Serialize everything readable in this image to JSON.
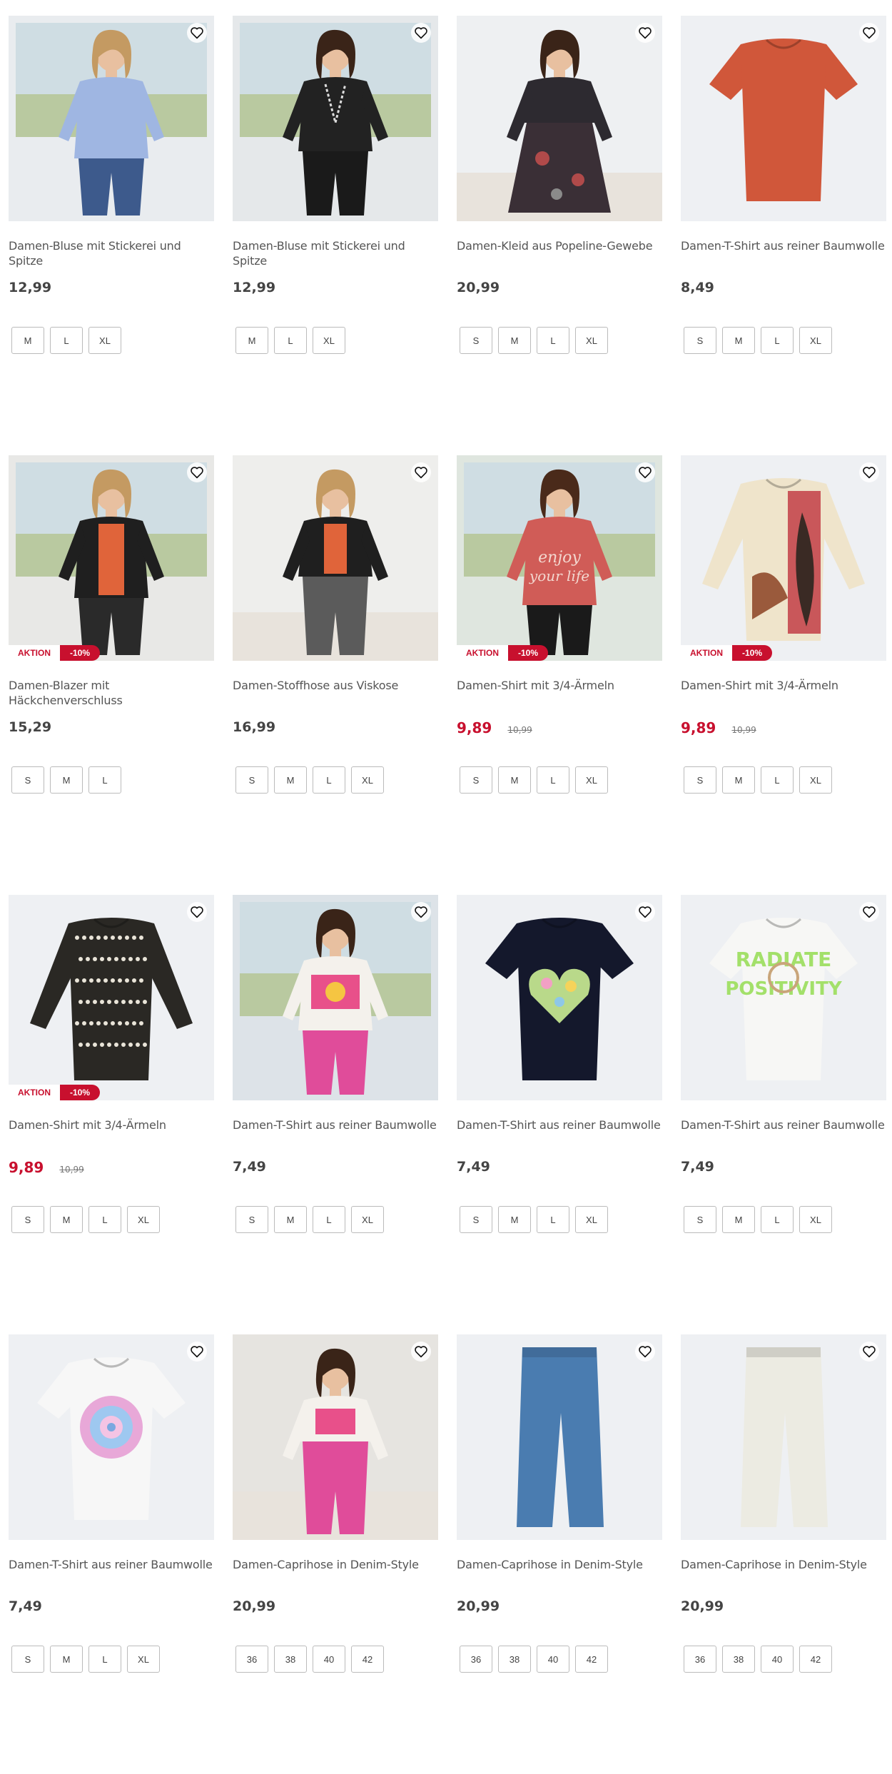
{
  "products": [
    {
      "name": "Damen-Bluse mit Stickerei und Spitze",
      "price": "12,99",
      "sizes": [
        "M",
        "L",
        "XL"
      ],
      "scene": "blouse-blue"
    },
    {
      "name": "Damen-Bluse mit Stickerei und Spitze",
      "price": "12,99",
      "sizes": [
        "M",
        "L",
        "XL"
      ],
      "scene": "blouse-black"
    },
    {
      "name": "Damen-Kleid aus Popeline-Gewebe",
      "price": "20,99",
      "sizes": [
        "S",
        "M",
        "L",
        "XL"
      ],
      "scene": "dress"
    },
    {
      "name": "Damen-T-Shirt aus reiner Baumwolle",
      "price": "8,49",
      "sizes": [
        "S",
        "M",
        "L",
        "XL"
      ],
      "scene": "tshirt-orange"
    },
    {
      "name": "Damen-Blazer mit Häckchenverschluss",
      "price": "15,29",
      "sizes": [
        "S",
        "M",
        "L"
      ],
      "scene": "blazer",
      "badge": {
        "label": "AKTION",
        "discount": "-10%"
      }
    },
    {
      "name": "Damen-Stoffhose aus Viskose",
      "price": "16,99",
      "sizes": [
        "S",
        "M",
        "L",
        "XL"
      ],
      "scene": "trousers"
    },
    {
      "name": "Damen-Shirt mit 3/4-Ärmeln",
      "price": "9,89",
      "old_price": "10,99",
      "sale": true,
      "sizes": [
        "S",
        "M",
        "L",
        "XL"
      ],
      "scene": "shirt-red",
      "badge": {
        "label": "AKTION",
        "discount": "-10%"
      }
    },
    {
      "name": "Damen-Shirt mit 3/4-Ärmeln",
      "price": "9,89",
      "old_price": "10,99",
      "sale": true,
      "sizes": [
        "S",
        "M",
        "L",
        "XL"
      ],
      "scene": "shirt-cream",
      "badge": {
        "label": "AKTION",
        "discount": "-10%"
      }
    },
    {
      "name": "Damen-Shirt mit 3/4-Ärmeln",
      "price": "9,89",
      "old_price": "10,99",
      "sale": true,
      "sizes": [
        "S",
        "M",
        "L",
        "XL"
      ],
      "scene": "shirt-pattern",
      "badge": {
        "label": "AKTION",
        "discount": "-10%"
      }
    },
    {
      "name": "Damen-T-Shirt aus reiner Baumwolle",
      "price": "7,49",
      "sizes": [
        "S",
        "M",
        "L",
        "XL"
      ],
      "scene": "tshirt-model"
    },
    {
      "name": "Damen-T-Shirt aus reiner Baumwolle",
      "price": "7,49",
      "sizes": [
        "S",
        "M",
        "L",
        "XL"
      ],
      "scene": "tshirt-navy"
    },
    {
      "name": "Damen-T-Shirt aus reiner Baumwolle",
      "price": "7,49",
      "sizes": [
        "S",
        "M",
        "L",
        "XL"
      ],
      "scene": "tshirt-white-green"
    },
    {
      "name": "Damen-T-Shirt aus reiner Baumwolle",
      "price": "7,49",
      "sizes": [
        "S",
        "M",
        "L",
        "XL"
      ],
      "scene": "tshirt-white-mandala"
    },
    {
      "name": "Damen-Caprihose in Denim-Style",
      "price": "20,99",
      "sizes": [
        "36",
        "38",
        "40",
        "42"
      ],
      "scene": "capri-pink"
    },
    {
      "name": "Damen-Caprihose in Denim-Style",
      "price": "20,99",
      "sizes": [
        "36",
        "38",
        "40",
        "42"
      ],
      "scene": "capri-denim"
    },
    {
      "name": "Damen-Caprihose in Denim-Style",
      "price": "20,99",
      "sizes": [
        "36",
        "38",
        "40",
        "42"
      ],
      "scene": "capri-white"
    }
  ],
  "icons": {
    "wishlist": "heart-outline-icon"
  },
  "colors": {
    "sale": "#c8102e",
    "text": "#444444",
    "image_bg": "#eef0f3"
  }
}
